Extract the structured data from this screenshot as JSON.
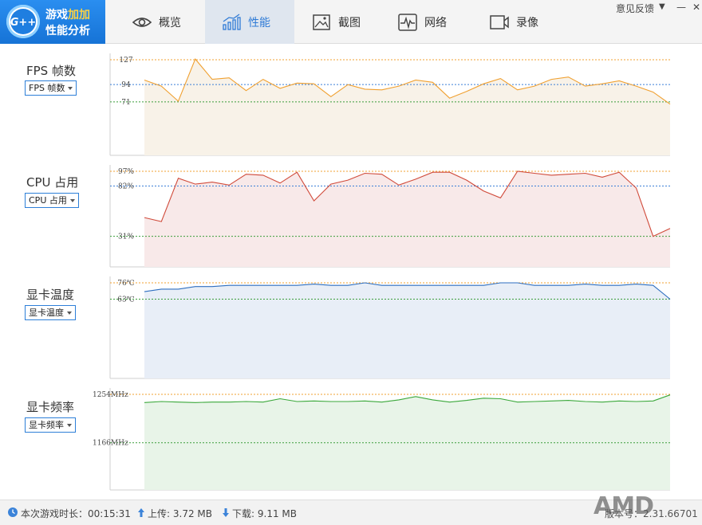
{
  "app": {
    "logo_badge": "G++",
    "logo_line1_a": "游戏",
    "logo_line1_b": "加加",
    "logo_line2": "性能分析"
  },
  "header": {
    "tabs": [
      {
        "label": "概览",
        "icon": "eye-icon",
        "active": false
      },
      {
        "label": "性能",
        "icon": "chart-bars-icon",
        "active": true
      },
      {
        "label": "截图",
        "icon": "image-icon",
        "active": false
      },
      {
        "label": "网络",
        "icon": "pulse-icon",
        "active": false
      },
      {
        "label": "录像",
        "icon": "video-icon",
        "active": false
      }
    ],
    "feedback": "意见反馈",
    "menu_icon": "▼",
    "minimize_icon": "—",
    "close_icon": "✕"
  },
  "panels": [
    {
      "title": "FPS 帧数",
      "selector": "FPS 帧数"
    },
    {
      "title": "CPU 占用",
      "selector": "CPU 占用"
    },
    {
      "title": "显卡温度",
      "selector": "显卡温度"
    },
    {
      "title": "显卡频率",
      "selector": "显卡频率"
    }
  ],
  "chart_data": [
    {
      "type": "area",
      "title": "FPS 帧数",
      "color": "#f0a030",
      "fill": "#f8f2e8",
      "ylim": [
        0,
        135
      ],
      "ref_lines": [
        {
          "value": 127,
          "label": "127",
          "color": "#f0a030"
        },
        {
          "value": 94,
          "label": "94",
          "color": "#3b7fd6"
        },
        {
          "value": 71,
          "label": "71",
          "color": "#3a9d3a"
        }
      ],
      "values": [
        100,
        92,
        72,
        128,
        101,
        103,
        86,
        101,
        89,
        96,
        95,
        78,
        94,
        88,
        87,
        92,
        100,
        97,
        76,
        85,
        95,
        102,
        87,
        92,
        101,
        104,
        92,
        95,
        99,
        92,
        84,
        68
      ]
    },
    {
      "type": "area",
      "title": "CPU 占用",
      "color": "#d04a3a",
      "fill": "#f8e9e9",
      "ylim": [
        0,
        102
      ],
      "ref_lines": [
        {
          "value": 97,
          "label": "97%",
          "color": "#f0a030"
        },
        {
          "value": 82,
          "label": "82%",
          "color": "#3b7fd6"
        },
        {
          "value": 31,
          "label": "31%",
          "color": "#3a9d3a"
        }
      ],
      "values": [
        50,
        46,
        90,
        84,
        86,
        83,
        94,
        93,
        85,
        96,
        67,
        84,
        88,
        95,
        94,
        83,
        89,
        96,
        96,
        88,
        77,
        70,
        97,
        95,
        93,
        94,
        95,
        91,
        96,
        80,
        31,
        39
      ]
    },
    {
      "type": "area",
      "title": "显卡温度",
      "color": "#2e6fc0",
      "fill": "#e8eef7",
      "ylim": [
        0,
        80
      ],
      "ref_lines": [
        {
          "value": 76,
          "label": "76℃",
          "color": "#f0a030"
        },
        {
          "value": 63,
          "label": "63℃",
          "color": "#3a9d3a"
        }
      ],
      "values": [
        69,
        71,
        71,
        73,
        73,
        74,
        74,
        74,
        74,
        74,
        75,
        74,
        74,
        76,
        74,
        74,
        74,
        74,
        74,
        74,
        74,
        76,
        76,
        74,
        74,
        74,
        75,
        74,
        74,
        75,
        74,
        63
      ]
    },
    {
      "type": "area",
      "title": "显卡频率",
      "color": "#3aa83a",
      "fill": "#e8f4e8",
      "ylim": [
        1080,
        1262
      ],
      "ref_lines": [
        {
          "value": 1254,
          "label": "1254MHz",
          "color": "#f0a030"
        },
        {
          "value": 1166,
          "label": "1166MHz",
          "color": "#3a9d3a"
        }
      ],
      "values": [
        1239,
        1241,
        1240,
        1239,
        1240,
        1240,
        1241,
        1240,
        1246,
        1241,
        1242,
        1241,
        1241,
        1242,
        1240,
        1244,
        1250,
        1244,
        1240,
        1243,
        1247,
        1246,
        1240,
        1241,
        1242,
        1243,
        1241,
        1240,
        1242,
        1241,
        1242,
        1253
      ]
    }
  ],
  "status": {
    "duration_label": "本次游戏时长：",
    "duration_value": "00:15:31",
    "upload_label": "上传:",
    "upload_value": "3.72 MB",
    "download_label": "下载:",
    "download_value": "9.11 MB",
    "version_label": "版本号：",
    "version_value": "2.31.66701",
    "brand_watermark": "AMD"
  }
}
